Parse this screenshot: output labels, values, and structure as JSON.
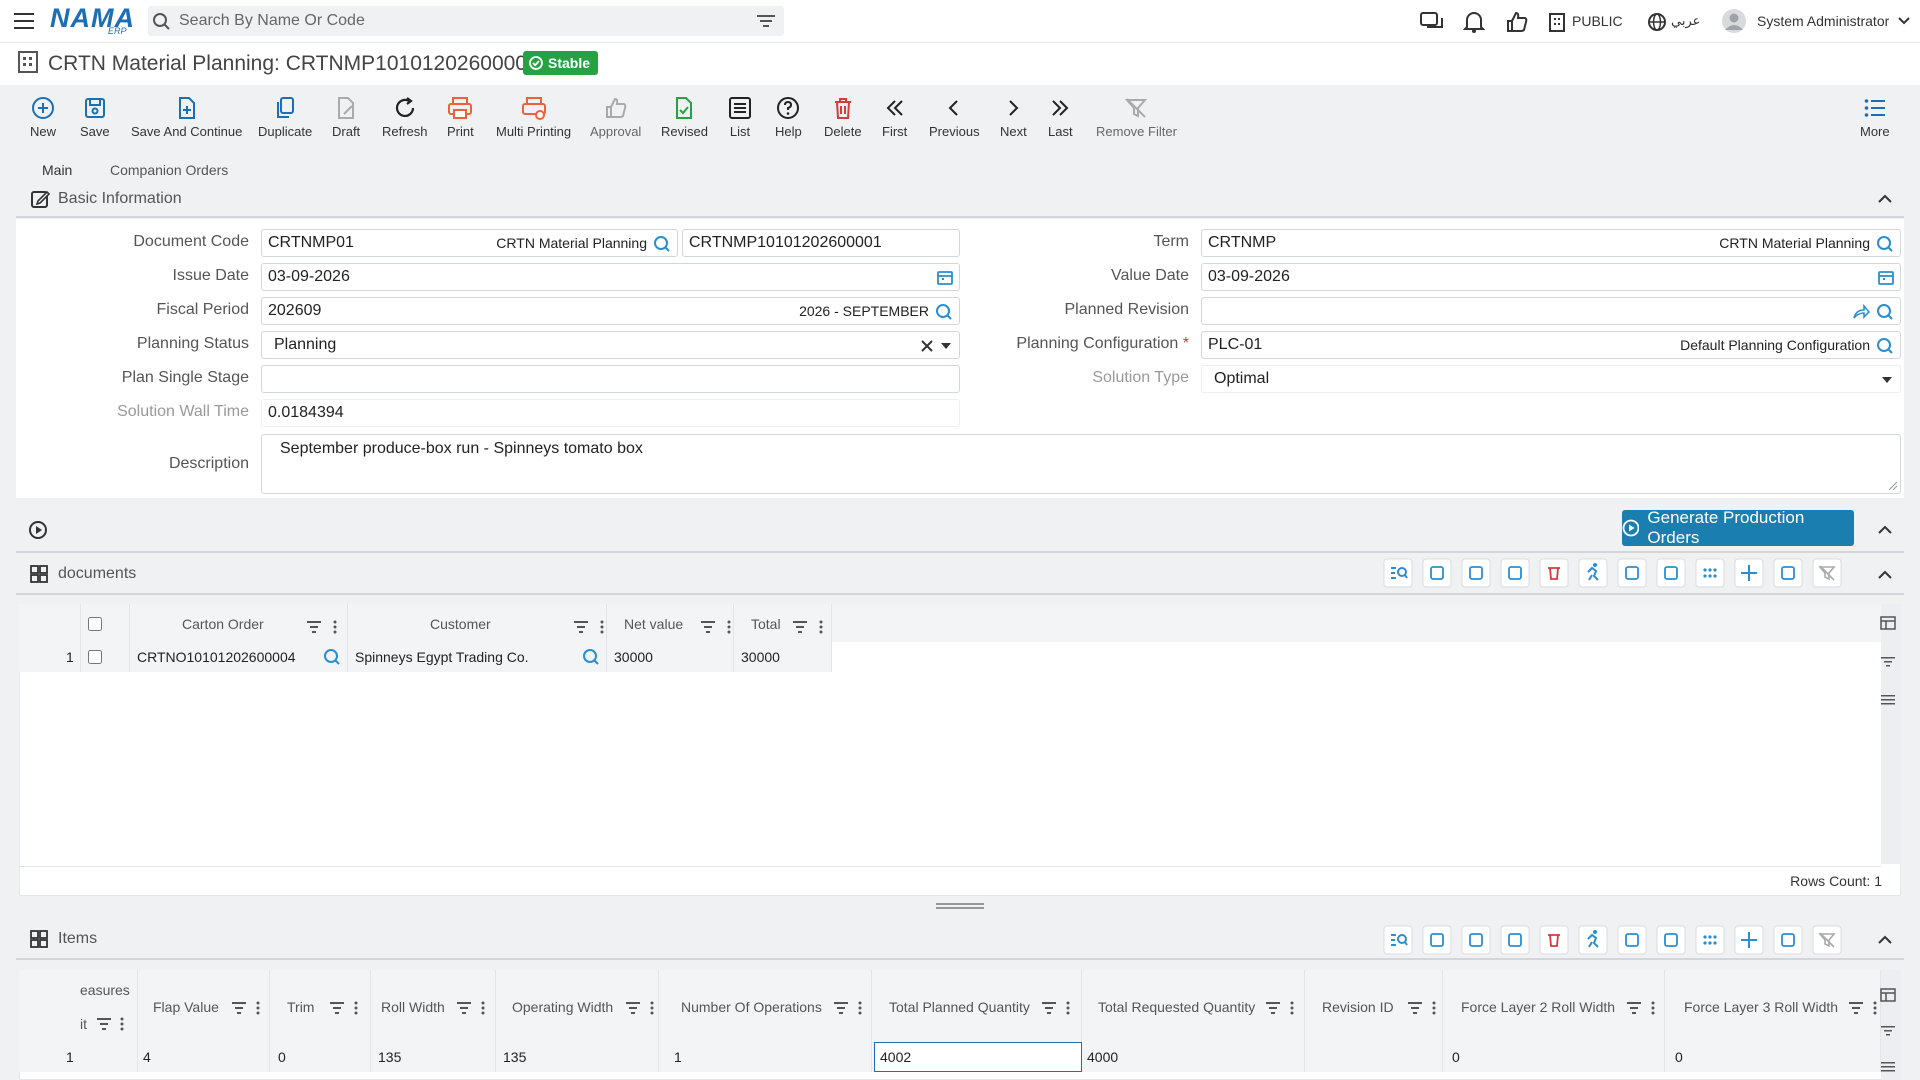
{
  "topbar": {
    "logo": "NAMA",
    "logo_sub": "ERP",
    "search_placeholder": "Search By Name Or Code",
    "public_label": "PUBLIC",
    "language_label": "عربي",
    "user_name": "System Administrator"
  },
  "page": {
    "title": "CRTN Material Planning: CRTNMP10101202600001",
    "status": "Stable"
  },
  "toolbar": {
    "new": "New",
    "save": "Save",
    "save_continue": "Save And Continue",
    "duplicate": "Duplicate",
    "draft": "Draft",
    "refresh": "Refresh",
    "print": "Print",
    "multi_printing": "Multi Printing",
    "approval": "Approval",
    "revised": "Revised",
    "list": "List",
    "help": "Help",
    "delete": "Delete",
    "first": "First",
    "previous": "Previous",
    "next": "Next",
    "last": "Last",
    "remove_filter": "Remove Filter",
    "more": "More"
  },
  "tabs": {
    "main": "Main",
    "companion": "Companion Orders"
  },
  "basic": {
    "section_title": "Basic Information",
    "document_code_label": "Document Code",
    "document_code": "CRTNMP01",
    "document_code_desc": "CRTN Material Planning",
    "document_number": "CRTNMP10101202600001",
    "issue_date_label": "Issue Date",
    "issue_date": "03-09-2026",
    "fiscal_period_label": "Fiscal Period",
    "fiscal_period": "202609",
    "fiscal_period_desc": "2026 - SEPTEMBER",
    "planning_status_label": "Planning Status",
    "planning_status": "Planning",
    "plan_single_stage_label": "Plan Single Stage",
    "plan_single_stage": "",
    "solution_wall_time_label": "Solution Wall Time",
    "solution_wall_time": "0.0184394",
    "description_label": "Description",
    "description": "September produce-box run - Spinneys tomato box",
    "term_label": "Term",
    "term": "CRTNMP",
    "term_desc": "CRTN Material Planning",
    "value_date_label": "Value Date",
    "value_date": "03-09-2026",
    "planned_revision_label": "Planned Revision",
    "planned_revision": "",
    "planning_config_label": "Planning Configuration",
    "planning_config_required": "*",
    "planning_config": "PLC-01",
    "planning_config_desc": "Default Planning Configuration",
    "solution_type_label": "Solution Type",
    "solution_type": "Optimal"
  },
  "generate_button": "Generate Production Orders",
  "documents": {
    "title": "documents",
    "columns": [
      "Carton Order",
      "Customer",
      "Net value",
      "Total"
    ],
    "rows": [
      {
        "num": "1",
        "carton_order": "CRTNO10101202600004",
        "customer": "Spinneys Egypt Trading Co.",
        "net_value": "30000",
        "total": "30000"
      }
    ],
    "rows_count": "Rows Count: 1"
  },
  "items": {
    "title": "Items",
    "partial_col_top": "easures",
    "partial_col_bottom": "it",
    "columns": [
      "Flap Value",
      "Trim",
      "Roll Width",
      "Operating Width",
      "Number Of Operations",
      "Total Planned Quantity",
      "Total Requested Quantity",
      "Revision ID",
      "Force Layer 2 Roll Width",
      "Force Layer 3 Roll Width"
    ],
    "rows": [
      {
        "num": "1",
        "flap_value": "4",
        "trim": "0",
        "roll_width": "135",
        "operating_width": "135",
        "number_of_operations": "1",
        "total_planned": "4002",
        "total_requested": "4000",
        "revision_id": "",
        "force2": "0",
        "force3": "0"
      }
    ]
  }
}
